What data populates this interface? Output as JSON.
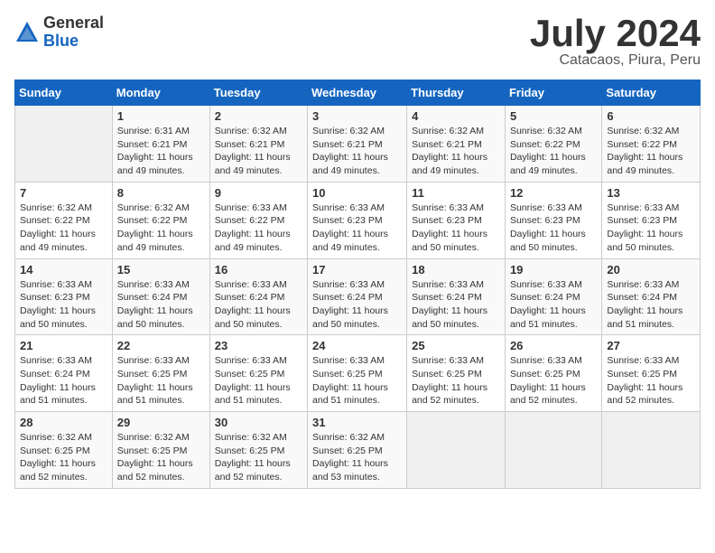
{
  "logo": {
    "general": "General",
    "blue": "Blue"
  },
  "title": "July 2024",
  "subtitle": "Catacaos, Piura, Peru",
  "weekdays": [
    "Sunday",
    "Monday",
    "Tuesday",
    "Wednesday",
    "Thursday",
    "Friday",
    "Saturday"
  ],
  "weeks": [
    [
      {
        "day": "",
        "info": ""
      },
      {
        "day": "1",
        "info": "Sunrise: 6:31 AM\nSunset: 6:21 PM\nDaylight: 11 hours\nand 49 minutes."
      },
      {
        "day": "2",
        "info": "Sunrise: 6:32 AM\nSunset: 6:21 PM\nDaylight: 11 hours\nand 49 minutes."
      },
      {
        "day": "3",
        "info": "Sunrise: 6:32 AM\nSunset: 6:21 PM\nDaylight: 11 hours\nand 49 minutes."
      },
      {
        "day": "4",
        "info": "Sunrise: 6:32 AM\nSunset: 6:21 PM\nDaylight: 11 hours\nand 49 minutes."
      },
      {
        "day": "5",
        "info": "Sunrise: 6:32 AM\nSunset: 6:22 PM\nDaylight: 11 hours\nand 49 minutes."
      },
      {
        "day": "6",
        "info": "Sunrise: 6:32 AM\nSunset: 6:22 PM\nDaylight: 11 hours\nand 49 minutes."
      }
    ],
    [
      {
        "day": "7",
        "info": "Sunrise: 6:32 AM\nSunset: 6:22 PM\nDaylight: 11 hours\nand 49 minutes."
      },
      {
        "day": "8",
        "info": "Sunrise: 6:32 AM\nSunset: 6:22 PM\nDaylight: 11 hours\nand 49 minutes."
      },
      {
        "day": "9",
        "info": "Sunrise: 6:33 AM\nSunset: 6:22 PM\nDaylight: 11 hours\nand 49 minutes."
      },
      {
        "day": "10",
        "info": "Sunrise: 6:33 AM\nSunset: 6:23 PM\nDaylight: 11 hours\nand 49 minutes."
      },
      {
        "day": "11",
        "info": "Sunrise: 6:33 AM\nSunset: 6:23 PM\nDaylight: 11 hours\nand 50 minutes."
      },
      {
        "day": "12",
        "info": "Sunrise: 6:33 AM\nSunset: 6:23 PM\nDaylight: 11 hours\nand 50 minutes."
      },
      {
        "day": "13",
        "info": "Sunrise: 6:33 AM\nSunset: 6:23 PM\nDaylight: 11 hours\nand 50 minutes."
      }
    ],
    [
      {
        "day": "14",
        "info": "Sunrise: 6:33 AM\nSunset: 6:23 PM\nDaylight: 11 hours\nand 50 minutes."
      },
      {
        "day": "15",
        "info": "Sunrise: 6:33 AM\nSunset: 6:24 PM\nDaylight: 11 hours\nand 50 minutes."
      },
      {
        "day": "16",
        "info": "Sunrise: 6:33 AM\nSunset: 6:24 PM\nDaylight: 11 hours\nand 50 minutes."
      },
      {
        "day": "17",
        "info": "Sunrise: 6:33 AM\nSunset: 6:24 PM\nDaylight: 11 hours\nand 50 minutes."
      },
      {
        "day": "18",
        "info": "Sunrise: 6:33 AM\nSunset: 6:24 PM\nDaylight: 11 hours\nand 50 minutes."
      },
      {
        "day": "19",
        "info": "Sunrise: 6:33 AM\nSunset: 6:24 PM\nDaylight: 11 hours\nand 51 minutes."
      },
      {
        "day": "20",
        "info": "Sunrise: 6:33 AM\nSunset: 6:24 PM\nDaylight: 11 hours\nand 51 minutes."
      }
    ],
    [
      {
        "day": "21",
        "info": "Sunrise: 6:33 AM\nSunset: 6:24 PM\nDaylight: 11 hours\nand 51 minutes."
      },
      {
        "day": "22",
        "info": "Sunrise: 6:33 AM\nSunset: 6:25 PM\nDaylight: 11 hours\nand 51 minutes."
      },
      {
        "day": "23",
        "info": "Sunrise: 6:33 AM\nSunset: 6:25 PM\nDaylight: 11 hours\nand 51 minutes."
      },
      {
        "day": "24",
        "info": "Sunrise: 6:33 AM\nSunset: 6:25 PM\nDaylight: 11 hours\nand 51 minutes."
      },
      {
        "day": "25",
        "info": "Sunrise: 6:33 AM\nSunset: 6:25 PM\nDaylight: 11 hours\nand 52 minutes."
      },
      {
        "day": "26",
        "info": "Sunrise: 6:33 AM\nSunset: 6:25 PM\nDaylight: 11 hours\nand 52 minutes."
      },
      {
        "day": "27",
        "info": "Sunrise: 6:33 AM\nSunset: 6:25 PM\nDaylight: 11 hours\nand 52 minutes."
      }
    ],
    [
      {
        "day": "28",
        "info": "Sunrise: 6:32 AM\nSunset: 6:25 PM\nDaylight: 11 hours\nand 52 minutes."
      },
      {
        "day": "29",
        "info": "Sunrise: 6:32 AM\nSunset: 6:25 PM\nDaylight: 11 hours\nand 52 minutes."
      },
      {
        "day": "30",
        "info": "Sunrise: 6:32 AM\nSunset: 6:25 PM\nDaylight: 11 hours\nand 52 minutes."
      },
      {
        "day": "31",
        "info": "Sunrise: 6:32 AM\nSunset: 6:25 PM\nDaylight: 11 hours\nand 53 minutes."
      },
      {
        "day": "",
        "info": ""
      },
      {
        "day": "",
        "info": ""
      },
      {
        "day": "",
        "info": ""
      }
    ]
  ]
}
